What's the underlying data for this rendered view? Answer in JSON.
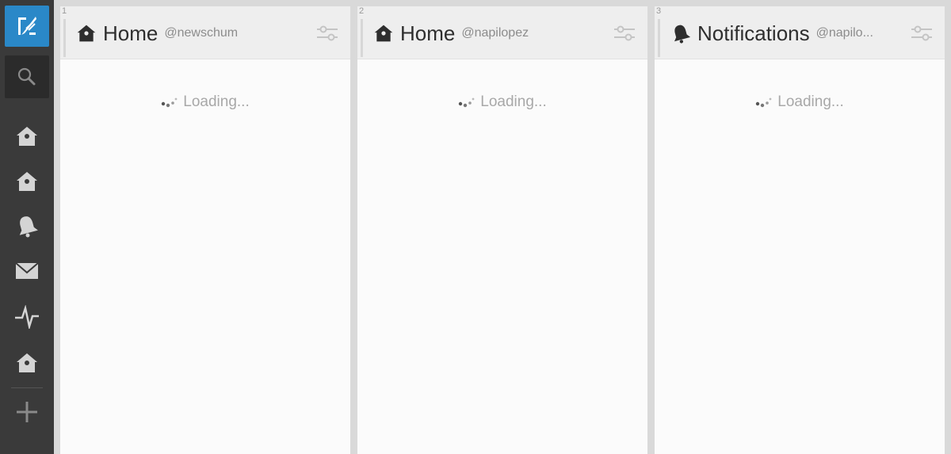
{
  "sidebar": {
    "compose": {
      "icon": "compose-quill-icon"
    },
    "search": {
      "icon": "search-icon"
    },
    "items": [
      {
        "icon": "home-icon"
      },
      {
        "icon": "home-icon"
      },
      {
        "icon": "notifications-bell-icon"
      },
      {
        "icon": "messages-envelope-icon"
      },
      {
        "icon": "activity-pulse-icon"
      },
      {
        "icon": "home-icon"
      }
    ],
    "add": {
      "icon": "add-column-icon"
    }
  },
  "columns": [
    {
      "number": "1",
      "title": "Home",
      "account": "@newschum",
      "icon": "home-icon",
      "loading": "Loading..."
    },
    {
      "number": "2",
      "title": "Home",
      "account": "@napilopez",
      "icon": "home-icon",
      "loading": "Loading..."
    },
    {
      "number": "3",
      "title": "Notifications",
      "account": "@napilo...",
      "icon": "notifications-bell-icon",
      "loading": "Loading..."
    }
  ],
  "colors": {
    "sidebar": "#3a3a3a",
    "accent": "#2a88c8",
    "background": "#d9d9d9"
  }
}
